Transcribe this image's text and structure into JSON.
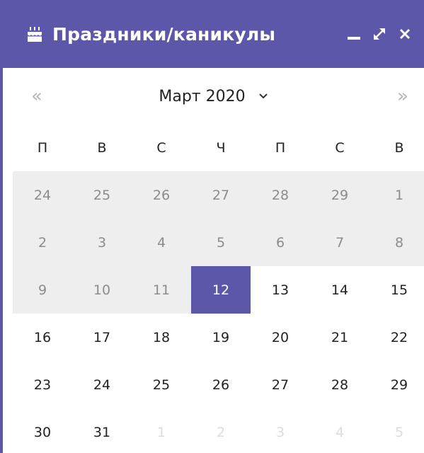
{
  "header": {
    "title": "Праздники/каникулы",
    "icon": "cake-icon",
    "controls": [
      "minimize-icon",
      "maximize-icon",
      "close-icon"
    ]
  },
  "nav": {
    "prev": "«",
    "next": "»",
    "month_label": "Март 2020"
  },
  "weekdays": [
    "П",
    "В",
    "С",
    "Ч",
    "П",
    "С",
    "В"
  ],
  "days": [
    {
      "d": "24",
      "s": "past"
    },
    {
      "d": "25",
      "s": "past"
    },
    {
      "d": "26",
      "s": "past"
    },
    {
      "d": "27",
      "s": "past"
    },
    {
      "d": "28",
      "s": "past"
    },
    {
      "d": "29",
      "s": "past"
    },
    {
      "d": "1",
      "s": "past"
    },
    {
      "d": "2",
      "s": "past"
    },
    {
      "d": "3",
      "s": "past"
    },
    {
      "d": "4",
      "s": "past"
    },
    {
      "d": "5",
      "s": "past"
    },
    {
      "d": "6",
      "s": "past"
    },
    {
      "d": "7",
      "s": "past"
    },
    {
      "d": "8",
      "s": "past"
    },
    {
      "d": "9",
      "s": "past"
    },
    {
      "d": "10",
      "s": "past"
    },
    {
      "d": "11",
      "s": "past"
    },
    {
      "d": "12",
      "s": "today"
    },
    {
      "d": "13",
      "s": "normal"
    },
    {
      "d": "14",
      "s": "normal"
    },
    {
      "d": "15",
      "s": "normal"
    },
    {
      "d": "16",
      "s": "normal"
    },
    {
      "d": "17",
      "s": "normal"
    },
    {
      "d": "18",
      "s": "normal"
    },
    {
      "d": "19",
      "s": "normal"
    },
    {
      "d": "20",
      "s": "normal"
    },
    {
      "d": "21",
      "s": "normal"
    },
    {
      "d": "22",
      "s": "normal"
    },
    {
      "d": "23",
      "s": "normal"
    },
    {
      "d": "24",
      "s": "normal"
    },
    {
      "d": "25",
      "s": "normal"
    },
    {
      "d": "26",
      "s": "normal"
    },
    {
      "d": "27",
      "s": "normal"
    },
    {
      "d": "28",
      "s": "normal"
    },
    {
      "d": "29",
      "s": "normal"
    },
    {
      "d": "30",
      "s": "normal"
    },
    {
      "d": "31",
      "s": "normal"
    },
    {
      "d": "1",
      "s": "other"
    },
    {
      "d": "2",
      "s": "other"
    },
    {
      "d": "3",
      "s": "other"
    },
    {
      "d": "4",
      "s": "other"
    },
    {
      "d": "5",
      "s": "other"
    }
  ],
  "colors": {
    "accent": "#5d57aa",
    "past_bg": "#eeeeee",
    "past_text": "#8c8c8c",
    "other_text": "#dcdcdc",
    "nav_arrow": "#b5b5b5"
  }
}
